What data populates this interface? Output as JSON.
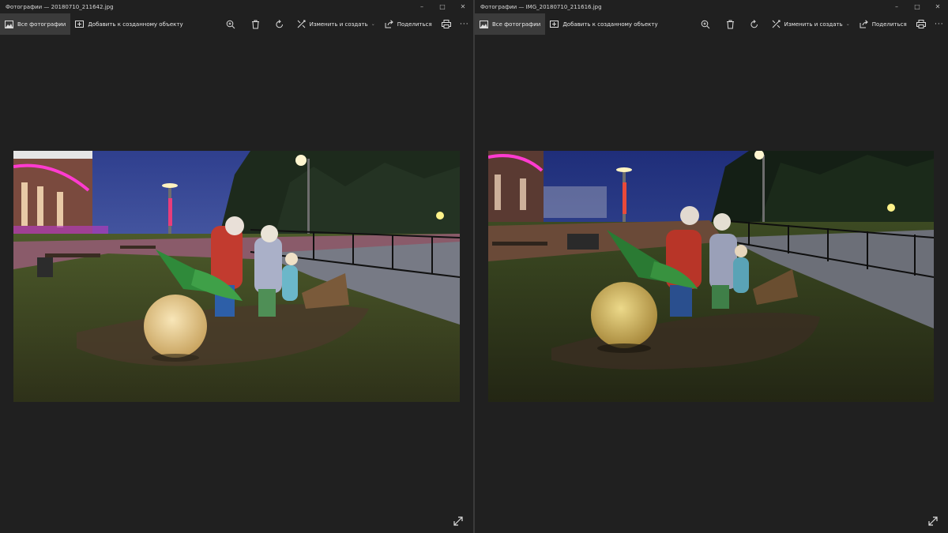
{
  "windows": [
    {
      "title": "Фотографии — 20180710_211642.jpg",
      "toolbar": {
        "all_photos": "Все фотографии",
        "add_to": "Добавить к созданному объекту",
        "edit_create": "Изменить и создать",
        "share": "Поделиться"
      }
    },
    {
      "title": "Фотографии — IMG_20180710_211616.jpg",
      "toolbar": {
        "all_photos": "Все фотографии",
        "add_to": "Добавить к созданному объекту",
        "edit_create": "Изменить и создать",
        "share": "Поделиться"
      }
    }
  ],
  "icons": [
    "photos-icon",
    "add-to-icon",
    "zoom-icon",
    "delete-icon",
    "rotate-icon",
    "edit-icon",
    "share-icon",
    "print-icon",
    "more-icon",
    "expand-icon",
    "minimize-icon",
    "maximize-icon",
    "close-icon"
  ],
  "colors": {
    "background": "#202020",
    "active_tab": "#3b3b3b",
    "sky": "#3b4f9a"
  }
}
